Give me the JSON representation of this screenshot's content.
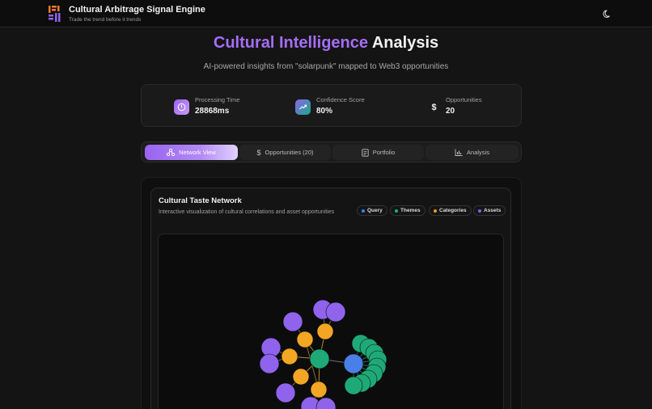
{
  "header": {
    "app_title": "Cultural Arbitrage Signal Engine",
    "app_subtitle": "Trade the trend before it trends",
    "theme_icon": "moon-icon"
  },
  "hero": {
    "title_part1": "Cultural Intelligence",
    "title_part2": "Analysis",
    "subtitle": "AI-powered insights from \"solarpunk\" mapped to Web3 opportunities"
  },
  "stats": [
    {
      "label": "Processing Time",
      "value": "28868ms",
      "icon": "clock-icon"
    },
    {
      "label": "Confidence Score",
      "value": "80%",
      "icon": "trending-up-icon"
    },
    {
      "label": "Opportunities",
      "value": "20",
      "icon": "dollar-icon"
    }
  ],
  "tabs": [
    {
      "label": "Network View",
      "icon": "network-icon",
      "active": true
    },
    {
      "label": "Opportunities (20)",
      "icon": "dollar-icon",
      "active": false
    },
    {
      "label": "Portfolio",
      "icon": "portfolio-icon",
      "active": false
    },
    {
      "label": "Analysis",
      "icon": "bar-chart-icon",
      "active": false
    }
  ],
  "network": {
    "title": "Cultural Taste Network",
    "description": "Interactive visualization of cultural correlations and asset opportunities",
    "legend": [
      {
        "label": "Query",
        "color": "#3b82f6"
      },
      {
        "label": "Themes",
        "color": "#10b981"
      },
      {
        "label": "Categories",
        "color": "#f59e0b"
      },
      {
        "label": "Assets",
        "color": "#8b5cf6"
      }
    ]
  },
  "colors": {
    "accent": "#a56ef5",
    "query": "#4a7fe8",
    "theme": "#1fa977",
    "category": "#f2a623",
    "asset": "#8f63ec"
  }
}
